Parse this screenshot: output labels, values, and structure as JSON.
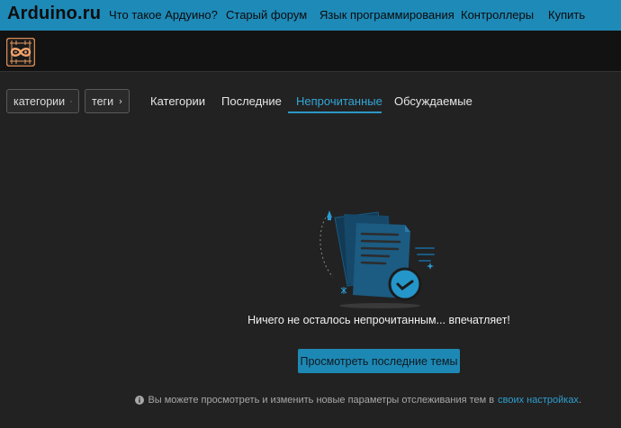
{
  "topnav": {
    "brand": "Arduino.ru",
    "links": [
      "Что такое Ардуино?",
      "Старый форум",
      "Язык программирования",
      "Контроллеры",
      "Купить"
    ]
  },
  "header": {
    "logo_icon": "arduino-infinity-logo"
  },
  "filters": {
    "categories_label": "категории",
    "tags_label": "теги"
  },
  "tabs": [
    {
      "label": "Категории",
      "active": false
    },
    {
      "label": "Последние",
      "active": false
    },
    {
      "label": "Непрочитанные",
      "active": true
    },
    {
      "label": "Обсуждаемые",
      "active": false
    }
  ],
  "empty_state": {
    "illustration_icon": "documents-checkmark-icon",
    "message": "Ничего не осталось непрочитанным... впечатляет!",
    "cta_label": "Просмотреть последние темы",
    "info_text": "Вы можете просмотреть и изменить новые параметры отслеживания тем в",
    "info_link": "своих настройках",
    "info_end": "."
  },
  "colors": {
    "accent": "#1e8ab8",
    "background": "#222222",
    "header": "#121212",
    "active_tab": "#33a6d6"
  }
}
